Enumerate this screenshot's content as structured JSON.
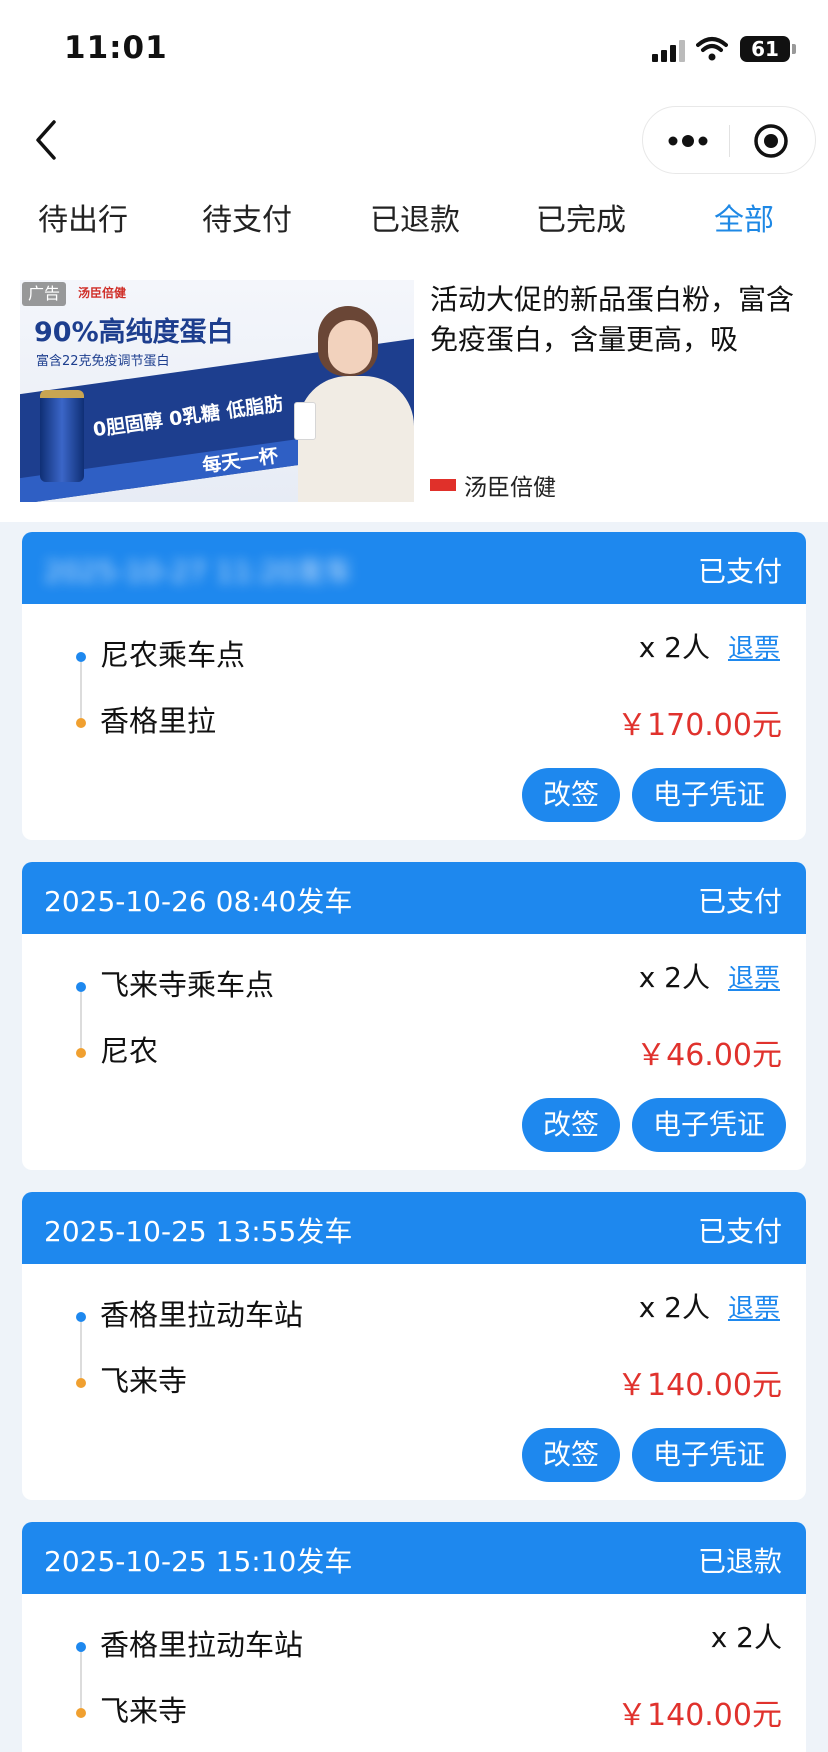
{
  "status_bar": {
    "time": "11:01",
    "battery": "61"
  },
  "tabs": [
    {
      "label": "待出行",
      "active": false
    },
    {
      "label": "待支付",
      "active": false
    },
    {
      "label": "已退款",
      "active": false
    },
    {
      "label": "已完成",
      "active": false
    },
    {
      "label": "全部",
      "active": true
    }
  ],
  "ad": {
    "badge": "广告",
    "image_brand": "汤臣倍健",
    "image_headline": "90%高纯度蛋白",
    "image_sub": "富含22克免疫调节蛋白",
    "image_claims": "0胆固醇 0乳糖 低脂肪",
    "image_slogan": "每天一杯",
    "description": "活动大促的新品蛋白粉，富含免疫蛋白，含量更高，吸",
    "source": "汤臣倍健"
  },
  "orders": [
    {
      "datetime": "",
      "status": "已支付",
      "from": "尼农乘车点",
      "to": "香格里拉",
      "passengers": "x 2人",
      "refund_label": "退票",
      "price": "￥170.00元",
      "change_label": "改签",
      "voucher_label": "电子凭证"
    },
    {
      "datetime": "2025-10-26   08:40发车",
      "status": "已支付",
      "from": "飞来寺乘车点",
      "to": "尼农",
      "passengers": "x 2人",
      "refund_label": "退票",
      "price": "￥46.00元",
      "change_label": "改签",
      "voucher_label": "电子凭证"
    },
    {
      "datetime": "2025-10-25   13:55发车",
      "status": "已支付",
      "from": "香格里拉动车站",
      "to": "飞来寺",
      "passengers": "x 2人",
      "refund_label": "退票",
      "price": "￥140.00元",
      "change_label": "改签",
      "voucher_label": "电子凭证"
    },
    {
      "datetime": "2025-10-25   15:10发车",
      "status": "已退款",
      "from": "香格里拉动车站",
      "to": "飞来寺",
      "passengers": "x 2人",
      "price": "￥140.00元"
    }
  ],
  "colors": {
    "accent": "#1e88ee",
    "price": "#e0322d",
    "from_dot": "#1e88ee",
    "to_dot": "#f0a030",
    "background": "#eef3f9"
  },
  "icons": [
    "back-arrow-icon",
    "more-dots-icon",
    "target-icon",
    "signal-icon",
    "wifi-icon",
    "battery-icon"
  ]
}
